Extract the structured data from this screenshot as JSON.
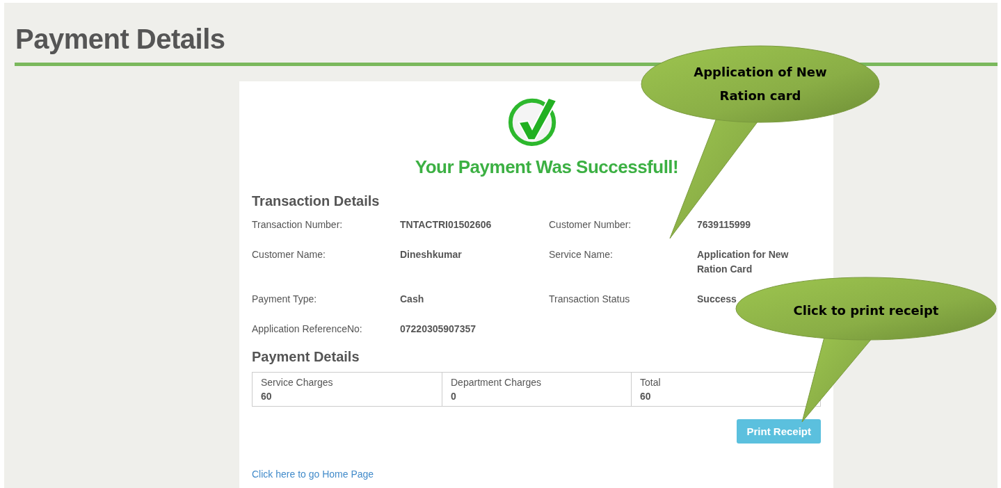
{
  "page_title": "Payment Details",
  "success_message": "Your Payment Was Successfull!",
  "transaction_details": {
    "heading": "Transaction Details",
    "fields": [
      {
        "label": "Transaction Number:",
        "value": "TNTACTRI01502606"
      },
      {
        "label": "Customer Number:",
        "value": "7639115999"
      },
      {
        "label": "Customer Name:",
        "value": "Dineshkumar"
      },
      {
        "label": "Service Name:",
        "value": "Application for New Ration Card"
      },
      {
        "label": "Payment Type:",
        "value": "Cash"
      },
      {
        "label": "Transaction Status",
        "value": "Success"
      },
      {
        "label": "Application ReferenceNo:",
        "value": "07220305907357"
      }
    ]
  },
  "payment_details": {
    "heading": "Payment Details",
    "columns": [
      {
        "label": "Service Charges",
        "value": "60"
      },
      {
        "label": "Department Charges",
        "value": "0"
      },
      {
        "label": "Total",
        "value": "60"
      }
    ]
  },
  "print_button": "Print Receipt",
  "home_link": "Click here to go Home Page",
  "callouts": [
    {
      "text": "Application of New Ration card"
    },
    {
      "text": "Click to print receipt"
    }
  ]
}
